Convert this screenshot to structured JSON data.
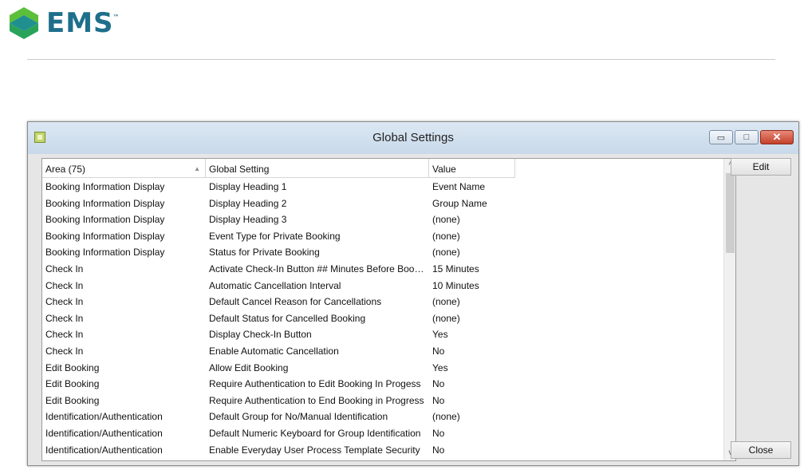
{
  "brand": {
    "name": "EMS",
    "tm": "™"
  },
  "window": {
    "title": "Global Settings",
    "controls": {
      "minimize": "▭",
      "restore": "□",
      "close": "✕"
    }
  },
  "grid": {
    "columns": {
      "area": "Area (75)",
      "setting": "Global Setting",
      "value": "Value"
    },
    "sort_indicator": "▲",
    "rows": [
      {
        "area": "Booking Information Display",
        "setting": "Display Heading 1",
        "value": "Event Name"
      },
      {
        "area": "Booking Information Display",
        "setting": "Display Heading 2",
        "value": "Group Name"
      },
      {
        "area": "Booking Information Display",
        "setting": "Display Heading 3",
        "value": "(none)"
      },
      {
        "area": "Booking Information Display",
        "setting": "Event Type for Private Booking",
        "value": "(none)"
      },
      {
        "area": "Booking Information Display",
        "setting": "Status for Private Booking",
        "value": "(none)"
      },
      {
        "area": "Check In",
        "setting": "Activate Check-In Button ## Minutes Before Booki...",
        "value": "15 Minutes"
      },
      {
        "area": "Check In",
        "setting": "Automatic Cancellation Interval",
        "value": "10 Minutes"
      },
      {
        "area": "Check In",
        "setting": "Default Cancel Reason for Cancellations",
        "value": "(none)"
      },
      {
        "area": "Check In",
        "setting": "Default Status for Cancelled Booking",
        "value": "(none)"
      },
      {
        "area": "Check In",
        "setting": "Display Check-In Button",
        "value": "Yes"
      },
      {
        "area": "Check In",
        "setting": "Enable Automatic Cancellation",
        "value": "No"
      },
      {
        "area": "Edit Booking",
        "setting": "Allow Edit Booking",
        "value": "Yes"
      },
      {
        "area": "Edit Booking",
        "setting": "Require Authentication to Edit Booking In Progess",
        "value": "No"
      },
      {
        "area": "Edit Booking",
        "setting": "Require Authentication to End Booking in Progress",
        "value": "No"
      },
      {
        "area": "Identification/Authentication",
        "setting": "Default Group for No/Manual Identification",
        "value": "(none)"
      },
      {
        "area": "Identification/Authentication",
        "setting": "Default Numeric Keyboard for Group Identification",
        "value": "No"
      },
      {
        "area": "Identification/Authentication",
        "setting": "Enable Everyday User Process Template Security",
        "value": "No"
      }
    ],
    "scroll": {
      "up": "^",
      "down": "v"
    }
  },
  "buttons": {
    "edit": "Edit",
    "close": "Close"
  }
}
